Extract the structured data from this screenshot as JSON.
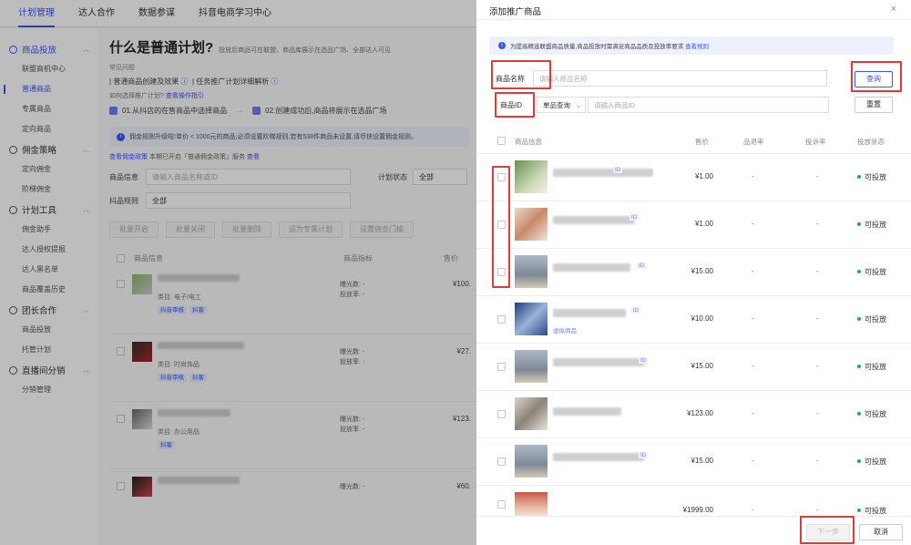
{
  "topnav": {
    "tabs": [
      "计划管理",
      "达人合作",
      "数据参谋",
      "抖音电商学习中心"
    ]
  },
  "sidebar": {
    "groups": [
      {
        "label": "商品投放",
        "items": [
          "联盟商机中心",
          "普通商品",
          "专属商品",
          "定向商品"
        ]
      },
      {
        "label": "佣金策略",
        "items": [
          "定向佣金",
          "阶梯佣金"
        ]
      },
      {
        "label": "计划工具",
        "items": [
          "佣金助手",
          "达人授权提报",
          "达人黑名单",
          "商品覆盖历史"
        ]
      },
      {
        "label": "团长合作",
        "items": [
          "商品投放",
          "托管计划"
        ]
      },
      {
        "label": "直播间分销",
        "items": [
          "分销管理"
        ]
      }
    ]
  },
  "main": {
    "title": "什么是普通计划?",
    "subtitle": "投放后商品可在联盟、商品库展示在选品广场、全部达人可见",
    "faq_label": "常见问题",
    "faq_1": "普通商品创建及效果",
    "faq_2": "任务推广计划详细解析",
    "guide": "如何选择推广计划?",
    "guide_link": "查看操作指引",
    "step_1": "01.从抖店的在售商品中选择商品",
    "step_2": "02.创建成功后,商品将展示在选品广场",
    "infobar": "佣金规则升级啦!单价 < 1000元的商品,必须设置阶梯规则,若有538件商品未设置,请尽快设置佣金规则。",
    "comm_link": "查看佣金政策",
    "comm_text": "本期已开启「普通佣金政策」服务",
    "comm_more": "查看",
    "filter_product_label": "商品信息",
    "filter_product_placeholder": "请输入商品名称或ID",
    "filter_status_label": "计划状态",
    "filter_status_value": "全部",
    "filter_rule_label": "抖品规则",
    "filter_rule_value": "全部",
    "batch_buttons": [
      "批量开启",
      "批量关闭",
      "批量删除",
      "设为专属计划",
      "设置佣金门槛"
    ],
    "col_product": "商品信息",
    "col_metric": "商品指标",
    "col_price": "售价",
    "rows": [
      {
        "category": "类目: 电子/电工",
        "tags": [
          "抖音审核",
          "抖客"
        ],
        "metric1": "曝光数: -",
        "metric2": "投放率: -",
        "price": "¥100."
      },
      {
        "category": "类目: 时尚饰品",
        "tags": [
          "抖音审核",
          "抖客"
        ],
        "metric1": "曝光数: -",
        "metric2": "投放率: -",
        "price": "¥27."
      },
      {
        "category": "类目: 办公用品",
        "tags": [
          "抖客"
        ],
        "metric1": "曝光数: -",
        "metric2": "投放率: -",
        "price": "¥123."
      },
      {
        "category": "",
        "tags": [],
        "metric1": "曝光数: -",
        "metric2": "",
        "price": "¥60."
      }
    ]
  },
  "drawer": {
    "title": "添加推广商品",
    "close": "×",
    "info": "为提高精选联盟商品质量,商品投放时需满足商品品质及投放率要求",
    "info_link": "查看规则",
    "name_label": "商品名称",
    "name_placeholder": "请输入商品名称",
    "id_label": "商品ID",
    "query_mode": "单品查询",
    "id_placeholder": "请输入商品ID",
    "query_button": "查询",
    "reset_button": "重置",
    "col_info": "商品信息",
    "col_price": "售价",
    "col_rate1": "品退率",
    "col_rate2": "投诉率",
    "col_status": "投放状态",
    "id_tag": "ID",
    "rows": [
      {
        "price": "¥1.00",
        "rate1": "-",
        "rate2": "-",
        "status": "可投放",
        "sub": ""
      },
      {
        "price": "¥1.00",
        "rate1": "-",
        "rate2": "-",
        "status": "可投放",
        "sub": ""
      },
      {
        "price": "¥15.00",
        "rate1": "-",
        "rate2": "-",
        "status": "可投放",
        "sub": ""
      },
      {
        "price": "¥10.00",
        "rate1": "-",
        "rate2": "-",
        "status": "可投放",
        "sub": "虚拟商品"
      },
      {
        "price": "¥15.00",
        "rate1": "-",
        "rate2": "-",
        "status": "可投放",
        "sub": ""
      },
      {
        "price": "¥123.00",
        "rate1": "-",
        "rate2": "-",
        "status": "可投放",
        "sub": ""
      },
      {
        "price": "¥15.00",
        "rate1": "-",
        "rate2": "-",
        "status": "可投放",
        "sub": ""
      },
      {
        "price": "¥1999.00",
        "rate1": "-",
        "rate2": "-",
        "status": "可投放",
        "sub": ""
      }
    ],
    "next_button": "下一步",
    "cancel_button": "取消"
  },
  "colors": {
    "accent": "#3955f6",
    "highlight": "#e53935",
    "status_ok": "#22b14c"
  }
}
